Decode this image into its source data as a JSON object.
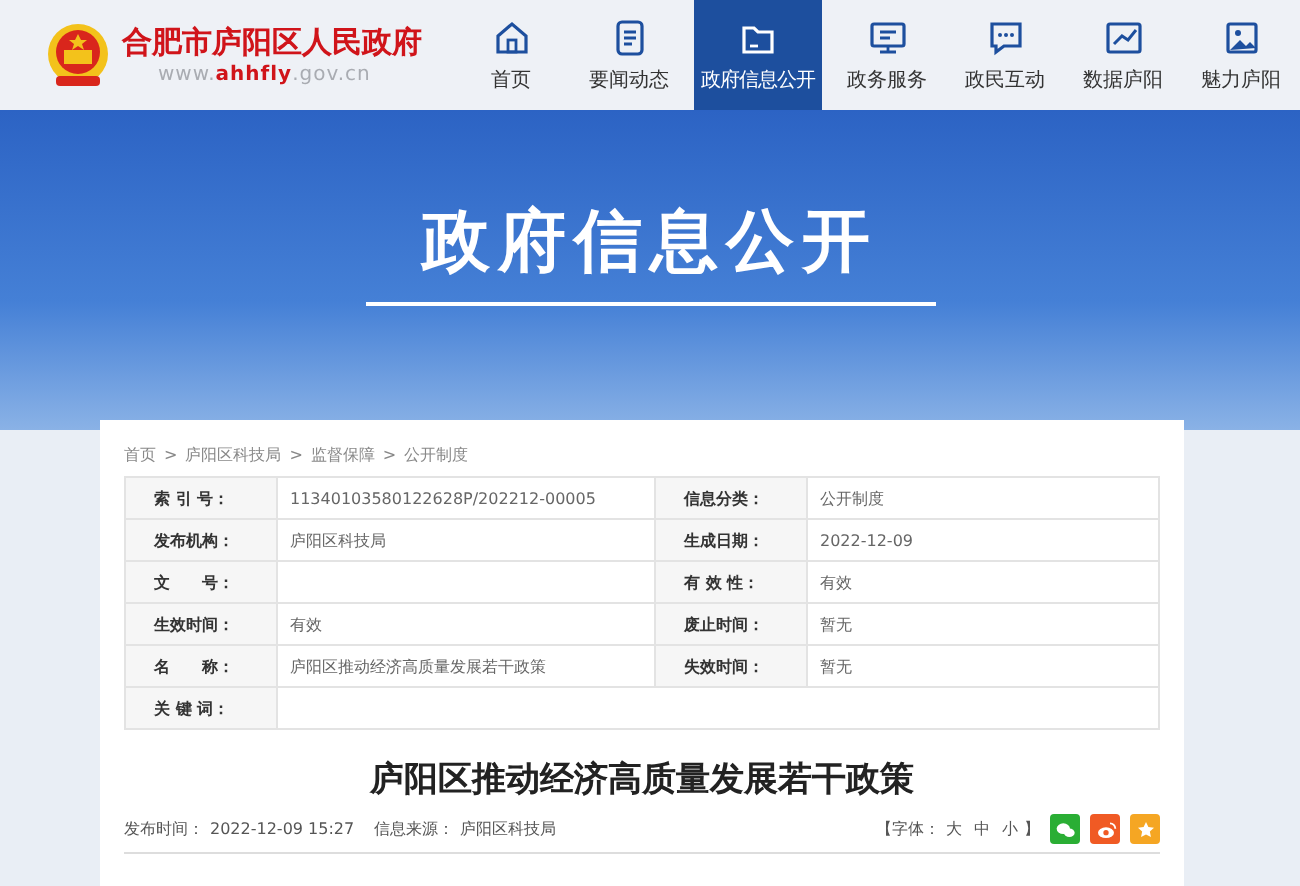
{
  "header": {
    "site_title": "合肥市庐阳区人民政府",
    "url_prefix": "www.",
    "url_highlight": "ahhfly",
    "url_suffix": ".gov.cn"
  },
  "nav": [
    {
      "label": "首页",
      "selected": false
    },
    {
      "label": "要闻动态",
      "selected": false
    },
    {
      "label": "政府信息公开",
      "selected": true
    },
    {
      "label": "政务服务",
      "selected": false
    },
    {
      "label": "政民互动",
      "selected": false
    },
    {
      "label": "数据庐阳",
      "selected": false
    },
    {
      "label": "魅力庐阳",
      "selected": false
    }
  ],
  "banner": {
    "title": "政府信息公开"
  },
  "breadcrumb": [
    "首页",
    "庐阳区科技局",
    "监督保障",
    "公开制度"
  ],
  "breadcrumb_separator": ">",
  "info_table": [
    [
      {
        "label": "索 引 号：",
        "value": "11340103580122628P/202212-00005"
      },
      {
        "label": "信息分类：",
        "value": "公开制度"
      }
    ],
    [
      {
        "label": "发布机构：",
        "value": "庐阳区科技局"
      },
      {
        "label": "生成日期：",
        "value": "2022-12-09"
      }
    ],
    [
      {
        "label": "文　　号："
      },
      {
        "label": "有 效 性：",
        "value": "有效"
      }
    ],
    [
      {
        "label": "生效时间：",
        "value": "有效"
      },
      {
        "label": "废止时间：",
        "value": "暂无"
      }
    ],
    [
      {
        "label": "名　　称：",
        "value": "庐阳区推动经济高质量发展若干政策"
      },
      {
        "label": "失效时间：",
        "value": "暂无"
      }
    ],
    [
      {
        "label": "关 键 词："
      }
    ]
  ],
  "article": {
    "title": "庐阳区推动经济高质量发展若干政策",
    "published_label": "发布时间：",
    "published": "2022-12-09 15:27",
    "source_label": "信息来源：",
    "source": "庐阳区科技局",
    "font_label": "【字体：",
    "font_sizes": [
      "大",
      "中",
      "小"
    ],
    "font_close": "】",
    "share": [
      {
        "color": "#2aae34"
      },
      {
        "color": "#f05a24"
      },
      {
        "color": "#f5a623"
      }
    ]
  }
}
